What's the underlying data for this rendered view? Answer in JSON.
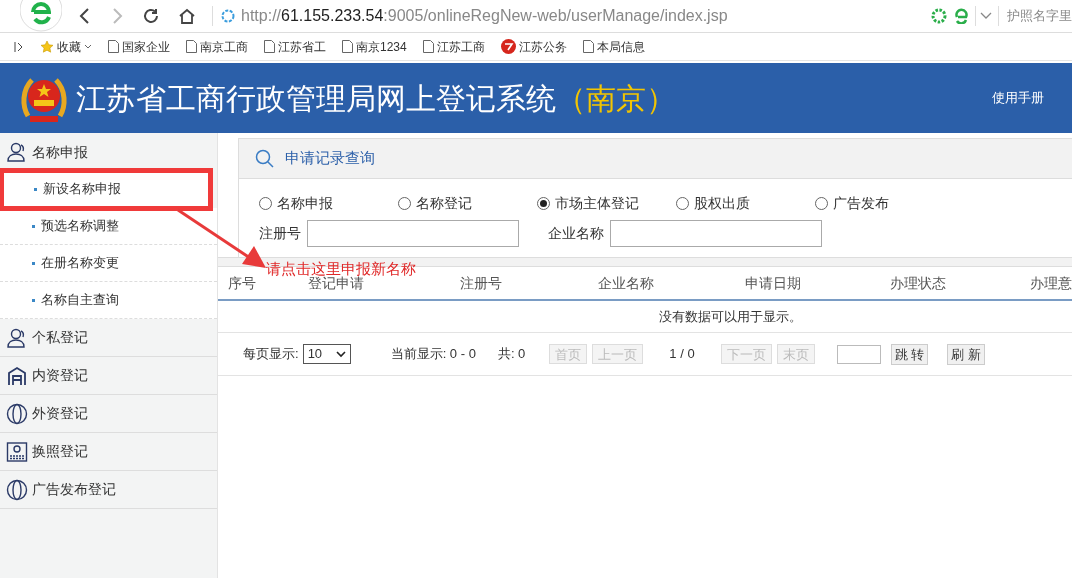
{
  "browser": {
    "url": {
      "scheme": "http://",
      "host": "61.155.233.54",
      "rest": ":9005/onlineRegNew-web/userManage/index.jsp"
    },
    "side_text": "护照名字里"
  },
  "bookmarks": [
    {
      "kind": "star",
      "label": "收藏"
    },
    {
      "kind": "page",
      "label": "国家企业"
    },
    {
      "kind": "page",
      "label": "南京工商"
    },
    {
      "kind": "page",
      "label": "江苏省工"
    },
    {
      "kind": "page",
      "label": "南京1234"
    },
    {
      "kind": "page",
      "label": "江苏工商"
    },
    {
      "kind": "logo",
      "label": "江苏公务"
    },
    {
      "kind": "page",
      "label": "本局信息"
    }
  ],
  "header": {
    "title": "江苏省工商行政管理局网上登记系统",
    "city": "（南京）",
    "manual_link": "使用手册"
  },
  "sidebar": [
    {
      "kind": "person",
      "label": "名称申报",
      "expanded": true,
      "children": [
        {
          "label": "新设名称申报",
          "selected": true
        },
        {
          "label": "预选名称调整",
          "selected": false
        },
        {
          "label": "在册名称变更",
          "selected": false
        },
        {
          "label": "名称自主查询",
          "selected": false
        }
      ]
    },
    {
      "kind": "person",
      "label": "个私登记",
      "expanded": false
    },
    {
      "kind": "building",
      "label": "内资登记",
      "expanded": false
    },
    {
      "kind": "globe",
      "label": "外资登记",
      "expanded": false
    },
    {
      "kind": "license",
      "label": "换照登记",
      "expanded": false
    },
    {
      "kind": "globe",
      "label": "广告发布登记",
      "expanded": false
    }
  ],
  "query": {
    "title": "申请记录查询",
    "radios": [
      {
        "label": "名称申报",
        "selected": false
      },
      {
        "label": "名称登记",
        "selected": false
      },
      {
        "label": "市场主体登记",
        "selected": true
      },
      {
        "label": "股权出质",
        "selected": false
      },
      {
        "label": "广告发布",
        "selected": false
      }
    ],
    "fields": [
      {
        "label": "注册号"
      },
      {
        "label": "企业名称"
      }
    ]
  },
  "annotation": "请点击这里申报新名称",
  "table": {
    "columns": [
      "序号",
      "登记申请",
      "注册号",
      "企业名称",
      "申请日期",
      "办理状态",
      "办理意"
    ],
    "empty_message": "没有数据可以用于显示。"
  },
  "pager": {
    "page_size_label": "每页显示:",
    "page_size": "10",
    "current_label": "当前显示: 0 - 0",
    "total_label": "共: 0",
    "buttons": [
      {
        "label": "首页",
        "disabled": true
      },
      {
        "label": "上一页",
        "disabled": true
      },
      {
        "label": "下一页",
        "disabled": true
      },
      {
        "label": "末页",
        "disabled": true
      }
    ],
    "page_info": "1 / 0",
    "jump_button": "跳 转",
    "refresh_button": "刷 新"
  }
}
